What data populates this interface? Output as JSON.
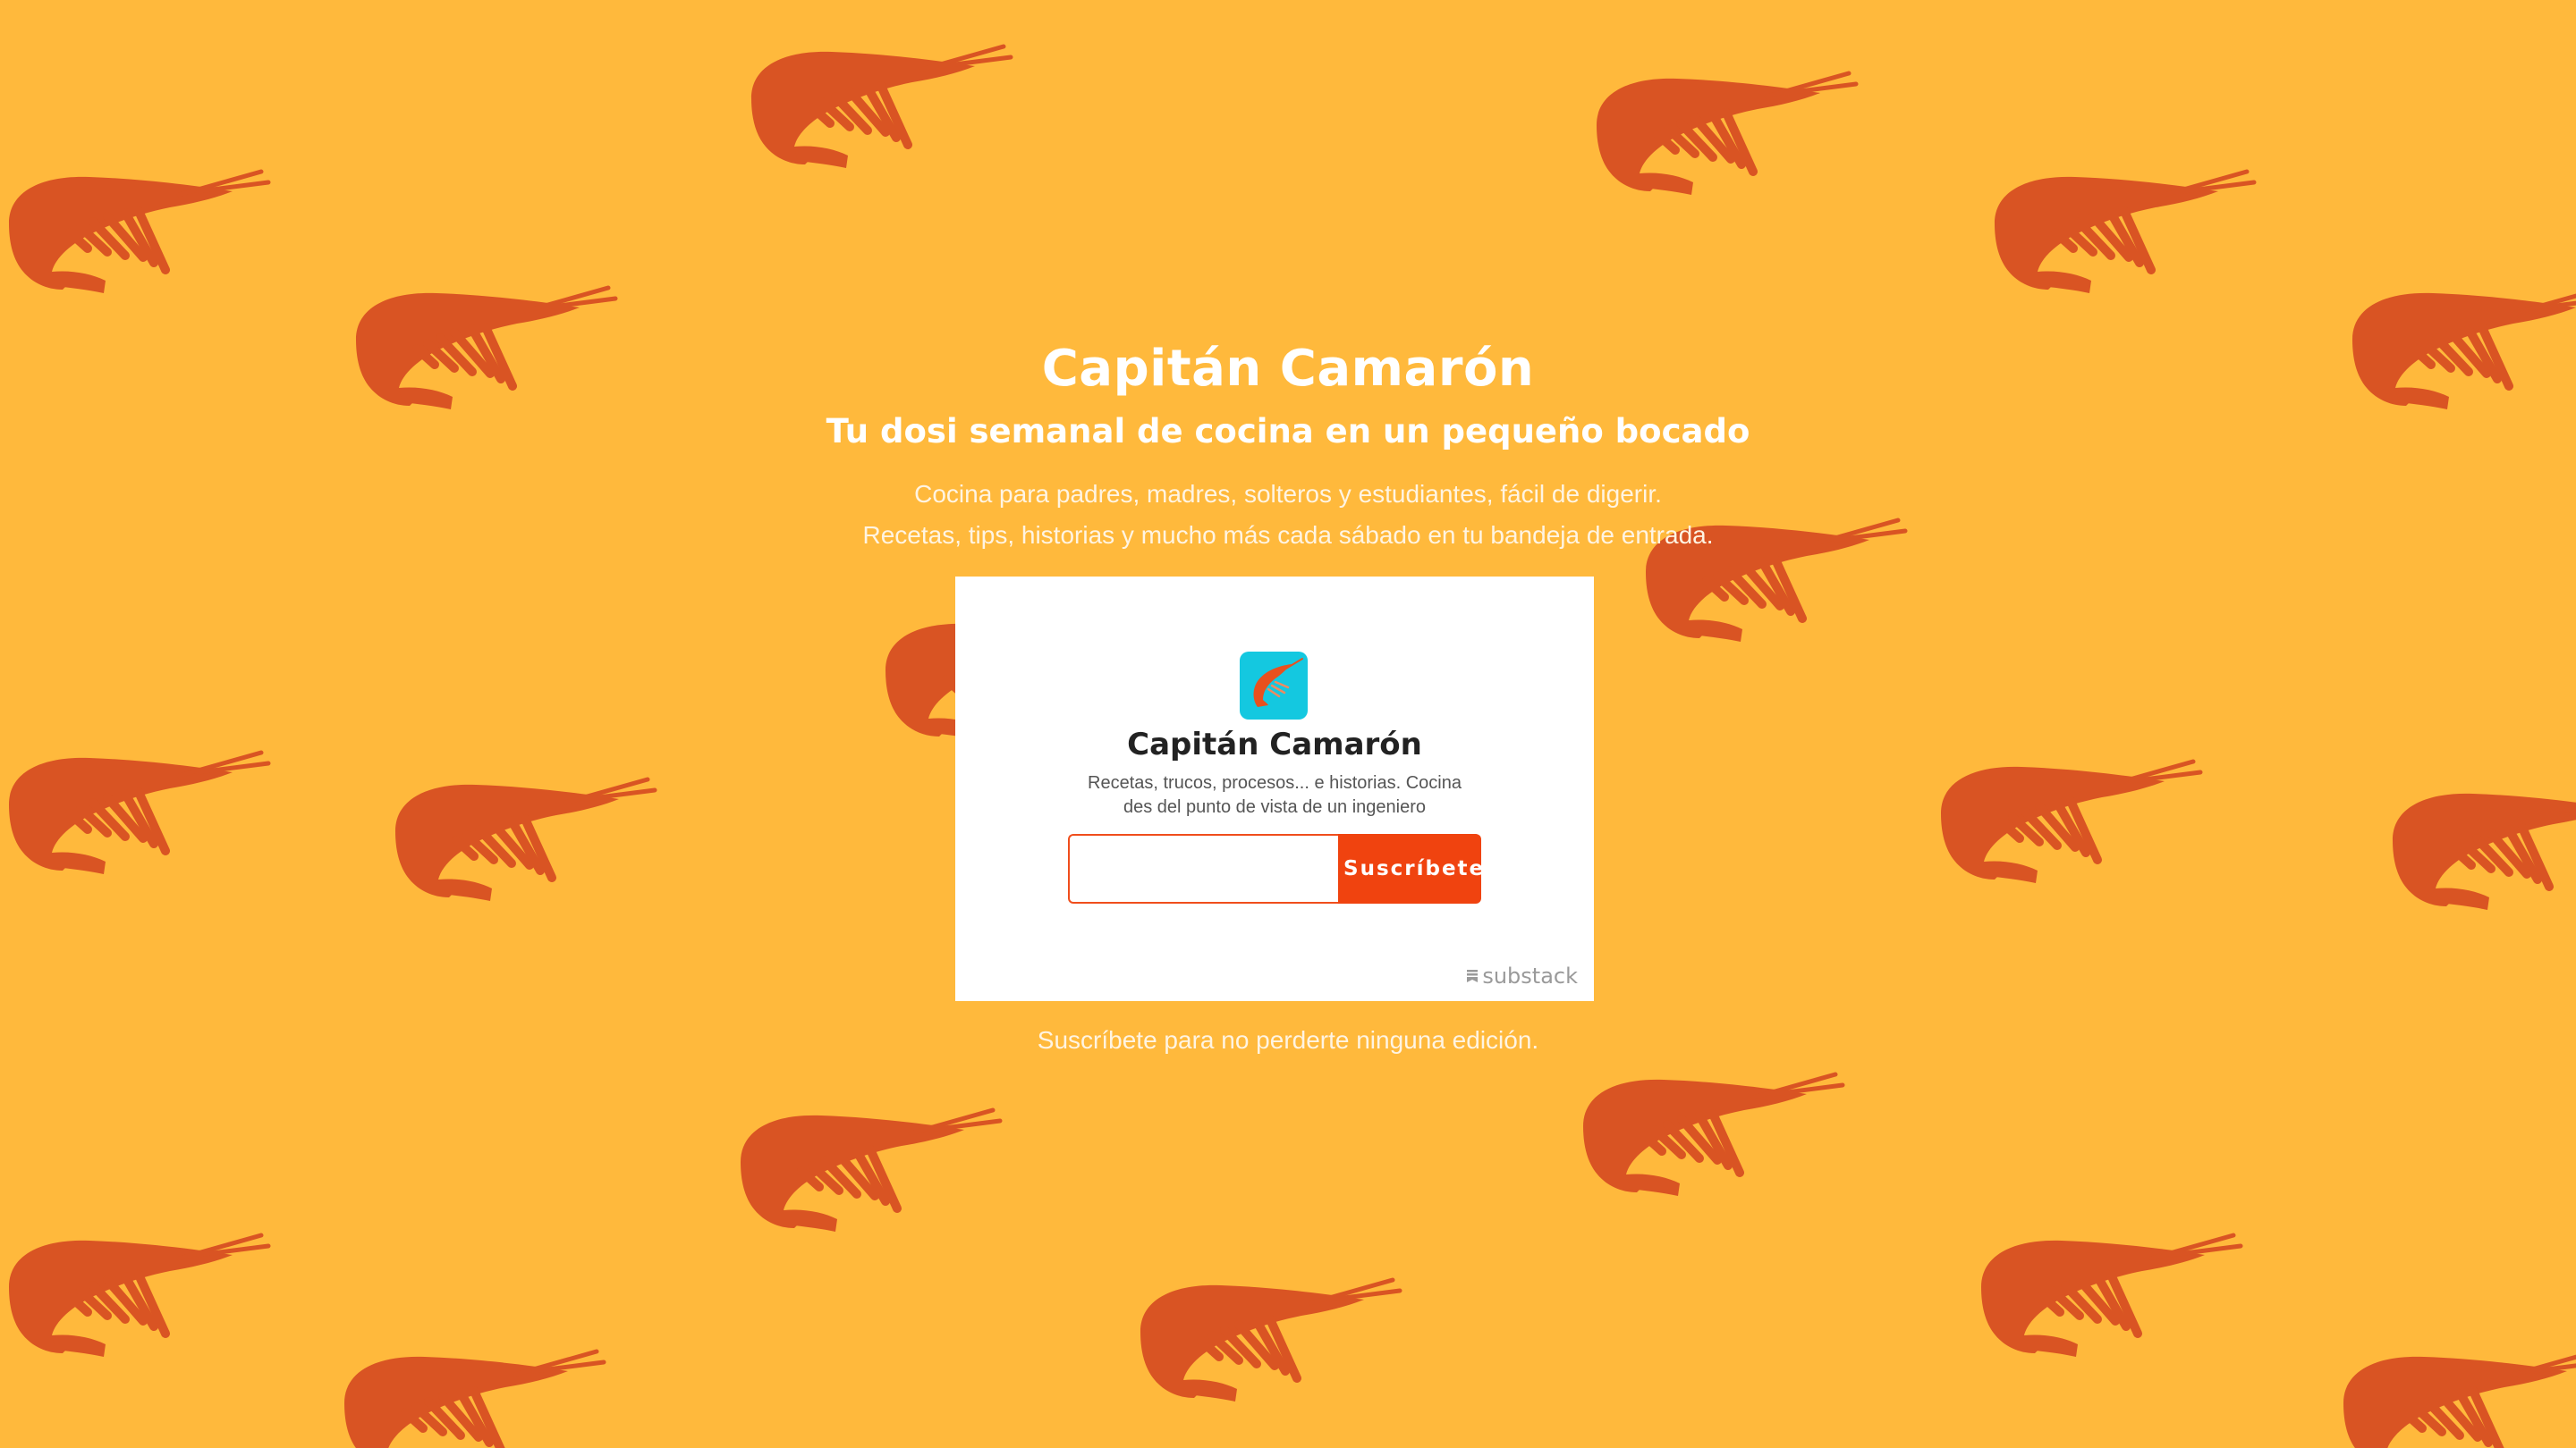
{
  "page": {
    "background_color": "#FFB93C",
    "pattern_color": "#D95423",
    "pattern_icon": "shrimp-icon"
  },
  "hero": {
    "title": "Capitán Camarón",
    "subtitle": "Tu dosi semanal de cocina en un pequeño bocado",
    "description_line_1": "Cocina para padres, madres, solteros y estudiantes, fácil de digerir.",
    "description_line_2": "Recetas, tips, historias y mucho más cada sábado en tu bandeja de entrada.",
    "cta_text": "Suscríbete para no perderte ninguna edición."
  },
  "embed": {
    "logo_icon": "shrimp-logo-icon",
    "logo_color": "#14C8E0",
    "title": "Capitán Camarón",
    "description_line_1": "Recetas, trucos, procesos... e historias. Cocina",
    "description_line_2": "des del punto de vista de un ingeniero",
    "email_value": "",
    "email_placeholder": "",
    "subscribe_label": "Suscríbete",
    "button_color": "#F0430F",
    "footer_brand": "substack"
  }
}
